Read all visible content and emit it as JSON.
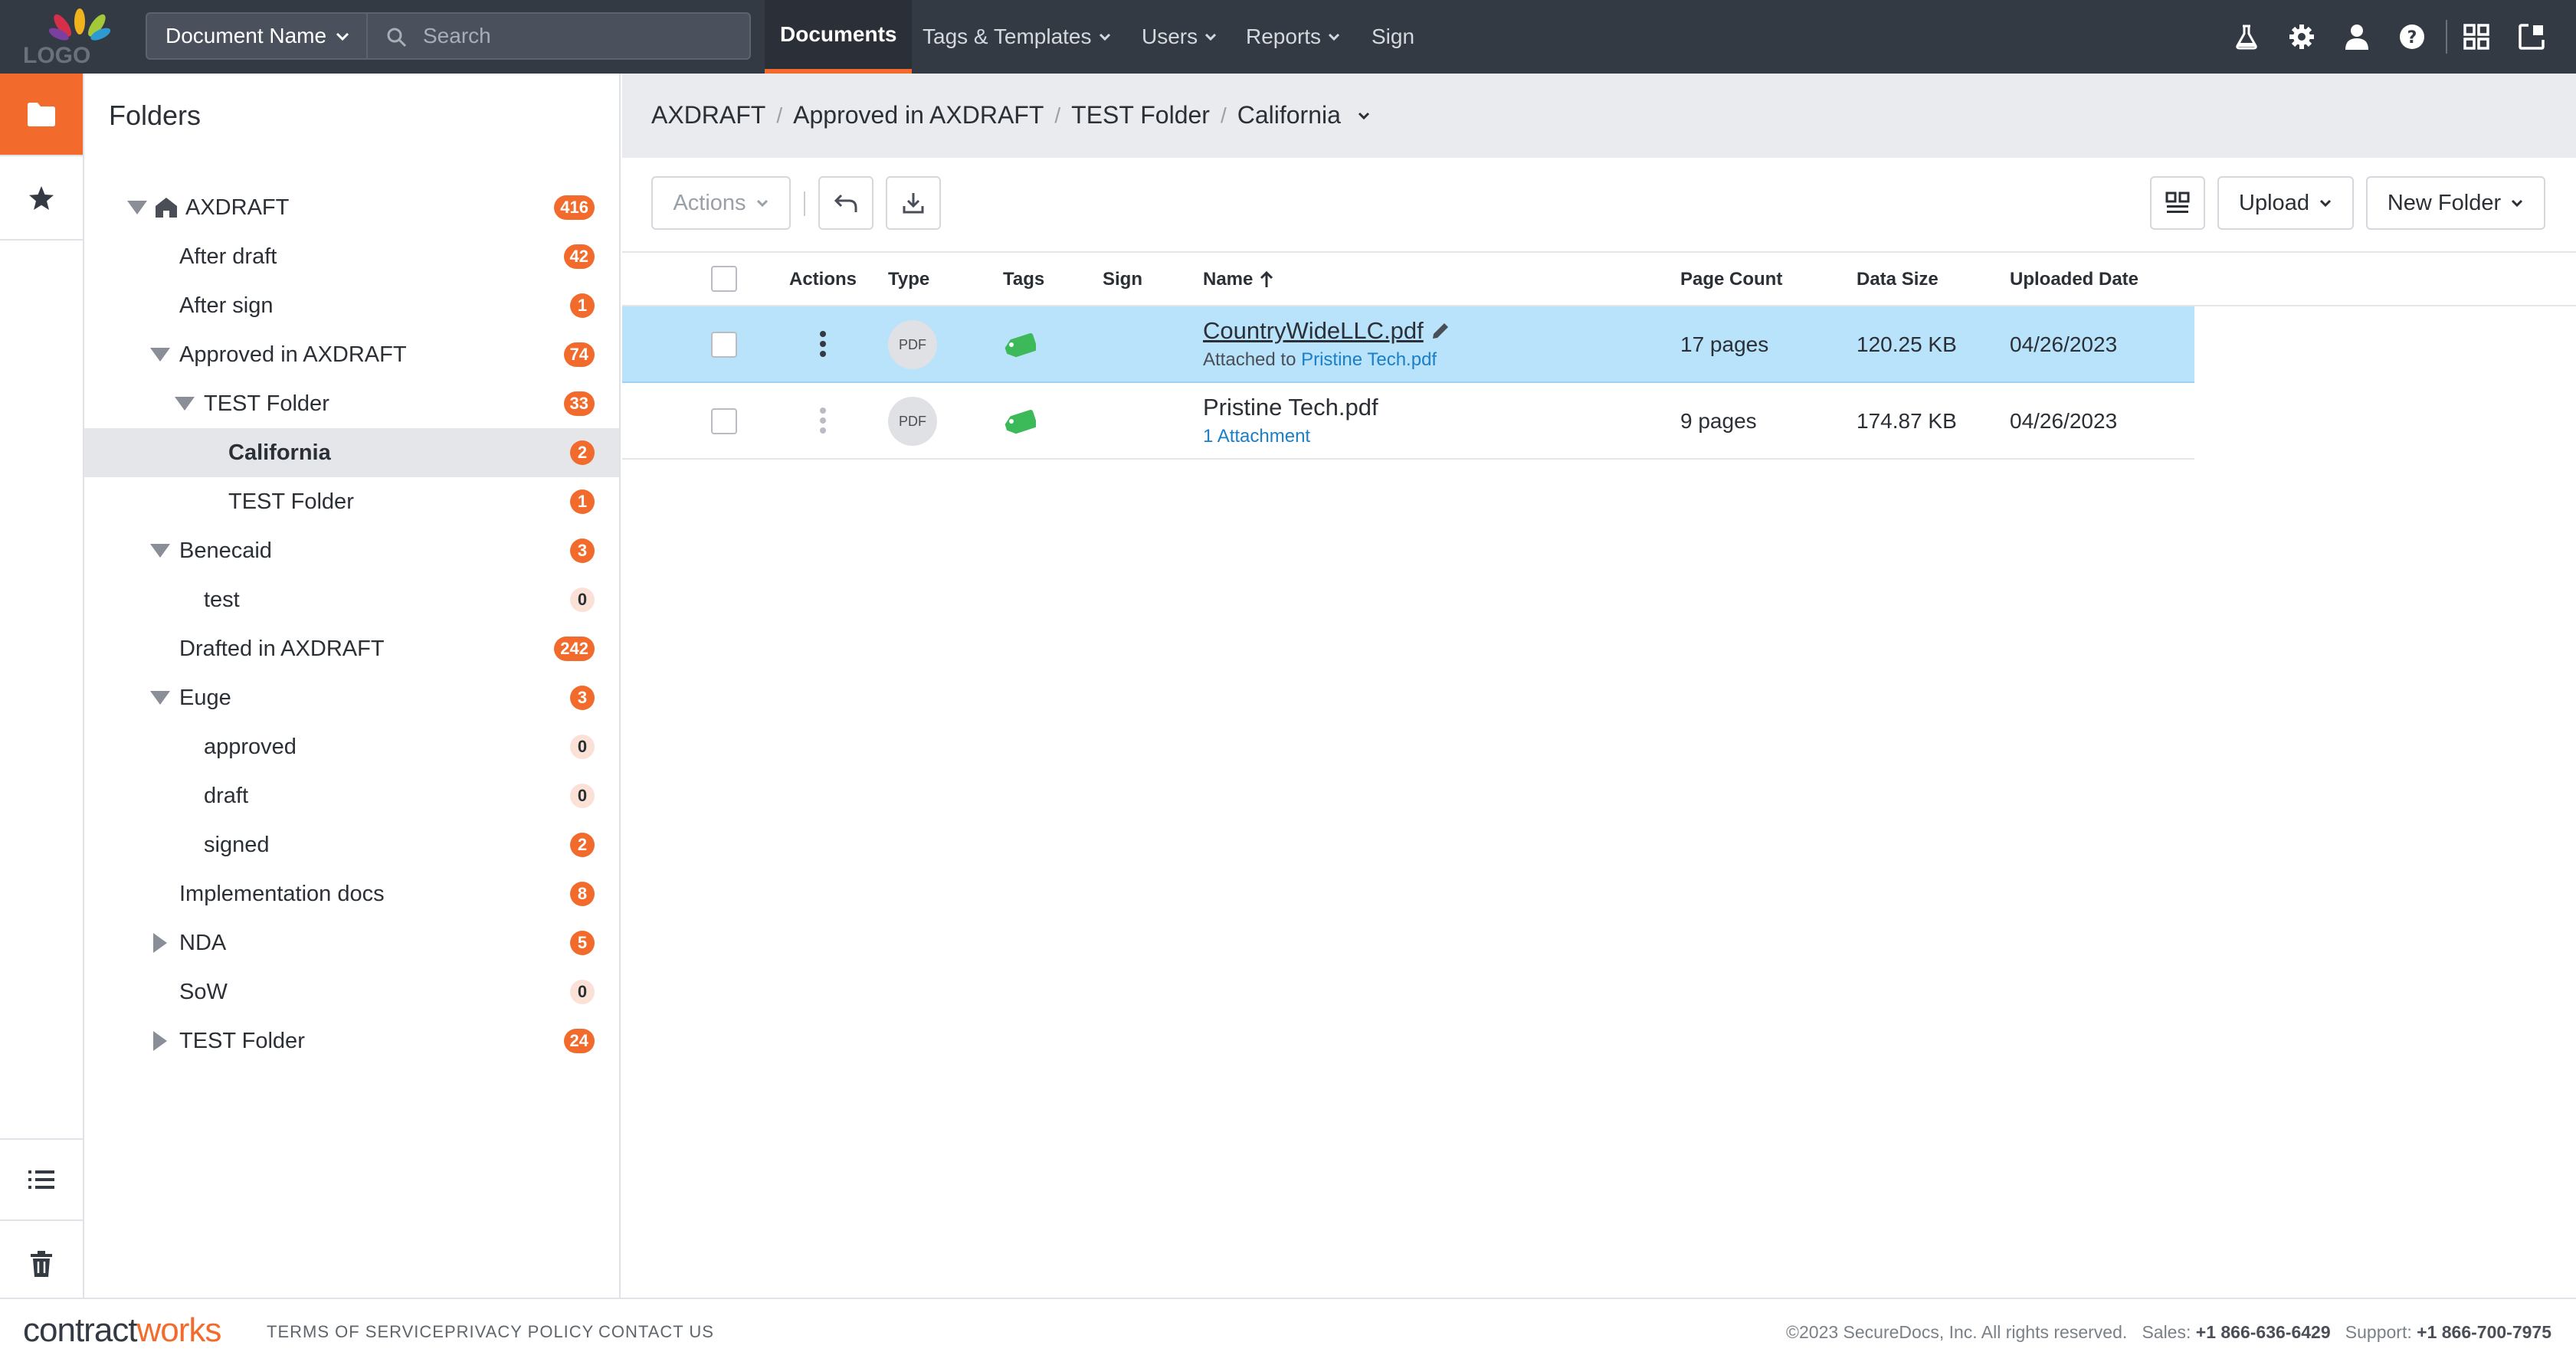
{
  "header": {
    "logo_text": "LOGO",
    "doc_selector": "Document Name",
    "search_placeholder": "Search",
    "tabs": [
      "Documents",
      "Tags & Templates",
      "Users",
      "Reports",
      "Sign"
    ],
    "active_tab": "Documents",
    "icons": [
      "flask-icon",
      "gear-icon",
      "user-icon",
      "help-icon",
      "apps-grid-icon",
      "switch-app-icon"
    ]
  },
  "rail": {
    "items": [
      "folder-icon",
      "star-icon",
      "list-icon",
      "trash-icon"
    ]
  },
  "tree": {
    "title": "Folders",
    "items": [
      {
        "label": "AXDRAFT",
        "count": "416"
      },
      {
        "label": "After draft",
        "count": "42"
      },
      {
        "label": "After sign",
        "count": "1"
      },
      {
        "label": "Approved in AXDRAFT",
        "count": "74"
      },
      {
        "label": "TEST Folder",
        "count": "33"
      },
      {
        "label": "California",
        "count": "2"
      },
      {
        "label": "TEST Folder",
        "count": "1"
      },
      {
        "label": "Benecaid",
        "count": "3"
      },
      {
        "label": "test",
        "count": "0"
      },
      {
        "label": "Drafted in AXDRAFT",
        "count": "242"
      },
      {
        "label": "Euge",
        "count": "3"
      },
      {
        "label": "approved",
        "count": "0"
      },
      {
        "label": "draft",
        "count": "0"
      },
      {
        "label": "signed",
        "count": "2"
      },
      {
        "label": "Implementation docs",
        "count": "8"
      },
      {
        "label": "NDA",
        "count": "5"
      },
      {
        "label": "SoW",
        "count": "0"
      },
      {
        "label": "TEST Folder",
        "count": "24"
      }
    ]
  },
  "breadcrumb": [
    "AXDRAFT",
    "Approved in AXDRAFT",
    "TEST Folder",
    "California"
  ],
  "toolbar": {
    "actions_label": "Actions",
    "upload_label": "Upload",
    "new_folder_label": "New Folder"
  },
  "table": {
    "columns": [
      "Actions",
      "Type",
      "Tags",
      "Sign",
      "Name",
      "Page Count",
      "Data Size",
      "Uploaded Date"
    ],
    "rows": [
      {
        "type": "PDF",
        "name": "CountryWideLLC.pdf",
        "sub_prefix": "Attached to",
        "sub_link": "Pristine Tech.pdf",
        "pages": "17 pages",
        "size": "120.25 KB",
        "date": "04/26/2023"
      },
      {
        "type": "PDF",
        "name": "Pristine Tech.pdf",
        "sub_link": "1 Attachment",
        "pages": "9 pages",
        "size": "174.87 KB",
        "date": "04/26/2023"
      }
    ]
  },
  "footer": {
    "brand_a": "contract",
    "brand_b": "works",
    "links": [
      "TERMS OF SERVICE",
      "PRIVACY POLICY",
      "CONTACT US"
    ],
    "copyright": "©2023 SecureDocs, Inc. All rights reserved.",
    "sales_label": "Sales:",
    "sales_phone": "+1 866-636-6429",
    "support_label": "Support:",
    "support_phone": "+1 866-700-7975"
  },
  "colors": {
    "accent": "#f26b2c",
    "topbar": "#343a44",
    "selected_row": "#b9e2fb",
    "link": "#1a7fc6",
    "tag": "#3cba5a"
  }
}
